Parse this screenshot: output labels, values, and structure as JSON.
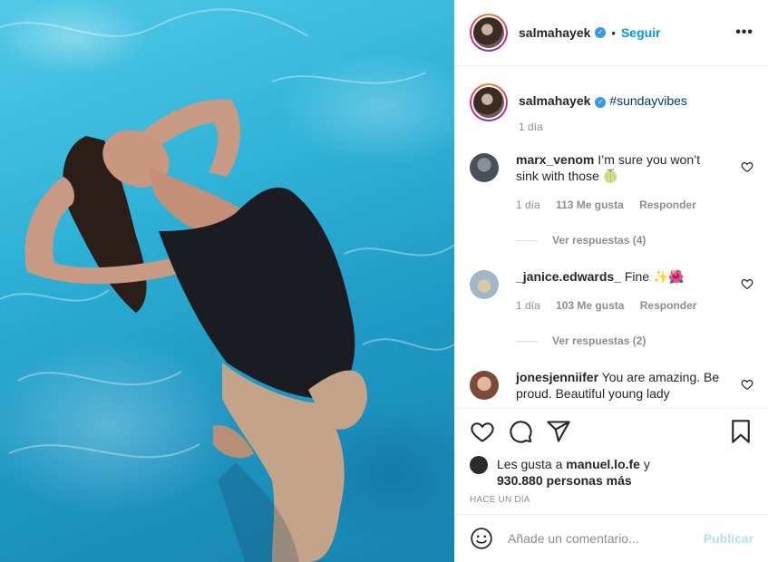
{
  "post": {
    "author": "salmahayek",
    "follow_label": "Seguir",
    "separator": "•",
    "more_label": "•••"
  },
  "caption": {
    "author": "salmahayek",
    "text": "#sundayvibes",
    "time": "1 día"
  },
  "comments": [
    {
      "user": "marx_venom",
      "text": "I’m sure you won’t sink with those 🍈",
      "time": "1 día",
      "likes": "113 Me gusta",
      "reply_label": "Responder",
      "view_replies": "Ver respuestas (4)"
    },
    {
      "user": "_janice.edwards_",
      "text": "Fine ✨🌺",
      "time": "1 día",
      "likes": "103 Me gusta",
      "reply_label": "Responder",
      "view_replies": "Ver respuestas (2)"
    },
    {
      "user": "jonesjenniifer",
      "text": "You are amazing. Be proud. Beautiful young lady"
    }
  ],
  "likes_summary": {
    "prefix": "Les gusta a",
    "user": "manuel.lo.fe",
    "connector": "y",
    "count": "930.880 personas más"
  },
  "posted_ago": "HACE UN DÍA",
  "comment_box": {
    "placeholder": "Añade un comentario...",
    "publish_label": "Publicar"
  },
  "icons": {
    "like": "heart-icon",
    "comment": "comment-icon",
    "share": "share-icon",
    "save": "bookmark-icon",
    "emoji": "emoji-icon",
    "verified": "verified-badge-icon",
    "more": "more-options-icon"
  },
  "colors": {
    "link_blue": "#0095f6",
    "publish_disabled": "#b2dffc",
    "muted": "#8e8e8e",
    "hashtag": "#00376b"
  }
}
